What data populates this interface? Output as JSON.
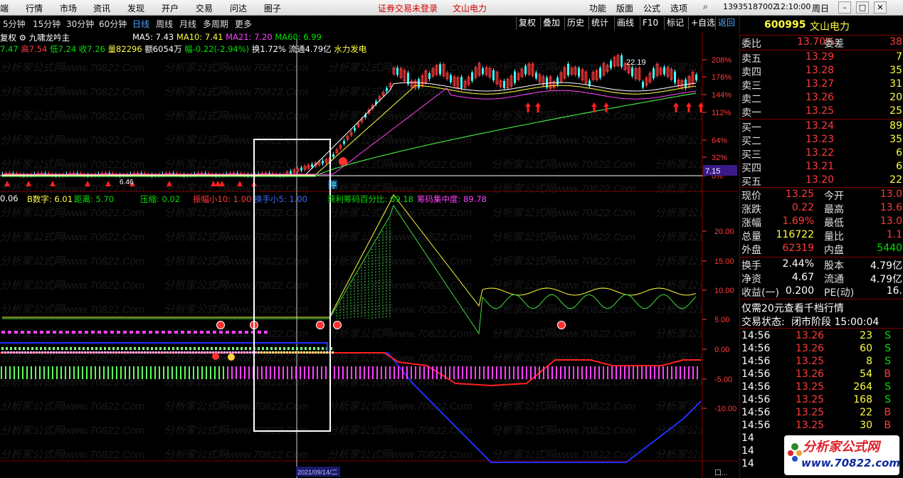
{
  "menu": {
    "items": [
      "端",
      "行情",
      "市场",
      "资讯",
      "发现",
      "开户",
      "交易",
      "问达",
      "圈子"
    ],
    "warning": "证券交易未登录",
    "stock_title": "文山电力",
    "right_items": [
      "功能",
      "版面",
      "公式",
      "选项"
    ],
    "account": "13935187002",
    "time": "12:10:00",
    "weekday": "周日"
  },
  "periods": {
    "items": [
      "5分钟",
      "15分钟",
      "30分钟",
      "60分钟",
      "日线",
      "周线",
      "月线",
      "多周期",
      "更多"
    ],
    "active": "日线",
    "tools": [
      "复权",
      "叠加",
      "历史",
      "统计",
      "画线",
      "F10",
      "标记",
      "+自选",
      "返回"
    ]
  },
  "main_info": {
    "fuquan": "复权",
    "formula": "九啸龙吟主",
    "ma5": "MA5: 7.43",
    "ma10": "MA10: 7.41",
    "ma21": "MA21: 7.20",
    "ma60": "MA60: 6.99",
    "open": "7.47",
    "high": "高7.54",
    "low": "低7.24",
    "close": "收7.26",
    "volume": "量82296",
    "amount": "额6054万",
    "change": "幅-0.22(-2.94%)",
    "turnover": "换1.72%",
    "float": "流通4.79亿",
    "concept": "水力发电",
    "peak_label": "22.19",
    "low_label": "6.46",
    "price_tag": "7.15",
    "stop_label": "停"
  },
  "main_axis": [
    "208%",
    "176%",
    "144%",
    "112%",
    "64%",
    "32%",
    "0%"
  ],
  "indicator_info": {
    "a": "0.06",
    "b": "B数字: 6.01",
    "c": "距离: 5.70",
    "d": "压缩: 0.02",
    "e": "振幅小10: 1.00",
    "f": "换手小5: 1.00",
    "g": "获利筹码百分比: 69.18",
    "h": "筹码集中度: 89.78"
  },
  "ind_axis": [
    "20.00",
    "15.00",
    "10.00",
    "5.00",
    "0.00",
    "-5.00",
    "-10.00"
  ],
  "bottom": {
    "date_label": "2021/09/14/二",
    "extra": "口..."
  },
  "quote": {
    "code": "600995",
    "name": "文山电力",
    "weibi_label": "委比",
    "weibi": "13.70%",
    "weicha_label": "委差",
    "weicha": "38",
    "sells": [
      {
        "label": "卖五",
        "price": "13.29",
        "vol": "7"
      },
      {
        "label": "卖四",
        "price": "13.28",
        "vol": "35"
      },
      {
        "label": "卖三",
        "price": "13.27",
        "vol": "31"
      },
      {
        "label": "卖二",
        "price": "13.26",
        "vol": "20"
      },
      {
        "label": "卖一",
        "price": "13.25",
        "vol": "25"
      }
    ],
    "buys": [
      {
        "label": "买一",
        "price": "13.24",
        "vol": "89"
      },
      {
        "label": "买二",
        "price": "13.23",
        "vol": "35"
      },
      {
        "label": "买三",
        "price": "13.22",
        "vol": "6"
      },
      {
        "label": "买四",
        "price": "13.21",
        "vol": "6"
      },
      {
        "label": "买五",
        "price": "13.20",
        "vol": "22"
      }
    ],
    "stats": [
      {
        "l1": "现价",
        "v1": "13.25",
        "c1": "red",
        "l2": "今开",
        "v2": "13.0",
        "c2": "red"
      },
      {
        "l1": "涨跌",
        "v1": "0.22",
        "c1": "red",
        "l2": "最高",
        "v2": "13.6",
        "c2": "red"
      },
      {
        "l1": "涨幅",
        "v1": "1.69%",
        "c1": "red",
        "l2": "最低",
        "v2": "13.0",
        "c2": "red"
      },
      {
        "l1": "总量",
        "v1": "116722",
        "c1": "yellow",
        "l2": "量比",
        "v2": "1.1",
        "c2": "red"
      },
      {
        "l1": "外盘",
        "v1": "62319",
        "c1": "red",
        "l2": "内盘",
        "v2": "5440",
        "c2": "green"
      }
    ],
    "stats2": [
      {
        "l1": "换手",
        "v1": "2.44%",
        "l2": "股本",
        "v2": "4.79亿"
      },
      {
        "l1": "净资",
        "v1": "4.67",
        "l2": "流通",
        "v2": "4.79亿"
      },
      {
        "l1": "收益(一)",
        "v1": "0.200",
        "l2": "PE(动)",
        "v2": "16."
      }
    ],
    "promo": "仅需20元查看千档行情",
    "status_label": "交易状态:",
    "status": "闭市阶段 15:00:04",
    "ticks": [
      {
        "t": "14:56",
        "p": "13.26",
        "v": "23",
        "s": "S"
      },
      {
        "t": "14:56",
        "p": "13.26",
        "v": "60",
        "s": "S"
      },
      {
        "t": "14:56",
        "p": "13.25",
        "v": "8",
        "s": "S"
      },
      {
        "t": "14:56",
        "p": "13.26",
        "v": "54",
        "s": "B"
      },
      {
        "t": "14:56",
        "p": "13.25",
        "v": "264",
        "s": "S"
      },
      {
        "t": "14:56",
        "p": "13.25",
        "v": "168",
        "s": "S"
      },
      {
        "t": "14:56",
        "p": "13.25",
        "v": "22",
        "s": "B"
      },
      {
        "t": "14:56",
        "p": "13.25",
        "v": "30",
        "s": "B"
      },
      {
        "t": "14",
        "p": "",
        "v": "",
        "s": ""
      },
      {
        "t": "14",
        "p": "",
        "v": "",
        "s": ""
      },
      {
        "t": "14",
        "p": "",
        "v": "",
        "s": ""
      }
    ]
  },
  "watermark": {
    "t1": "分析家公式网",
    "t2": "www.70822.com"
  },
  "colors": {
    "up": "#ff3b3b",
    "down": "#40ffff",
    "ma5": "#ffffff",
    "ma10": "#ffff40",
    "ma21": "#ff40ff",
    "ma60": "#40e040",
    "highlight_box": "#ffffff"
  }
}
